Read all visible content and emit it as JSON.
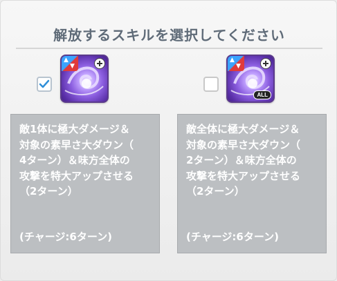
{
  "title": "解放するスキルを選択してください",
  "options": [
    {
      "checked": true,
      "icon": "purple-swirl-skill-icon",
      "badge_all": "",
      "description": "敵1体に極大ダメージ＆\n対象の素早さ大ダウン（\n4ターン）＆味方全体の\n攻撃を特大アップさせる\n（2ターン）",
      "charge": "(チャージ:6ターン)"
    },
    {
      "checked": false,
      "icon": "purple-swirl-skill-icon",
      "badge_all": "ALL",
      "description": "敵全体に極大ダメージ＆\n対象の素早さ大ダウン（\n2ターン）＆味方全体の\n攻撃を特大アップさせる\n（2ターン）",
      "charge": "(チャージ:6ターン)"
    }
  ],
  "colors": {
    "checkmark": "#2f8fd8",
    "card_bg": "#bcbfc2",
    "title": "#5f6b78"
  }
}
